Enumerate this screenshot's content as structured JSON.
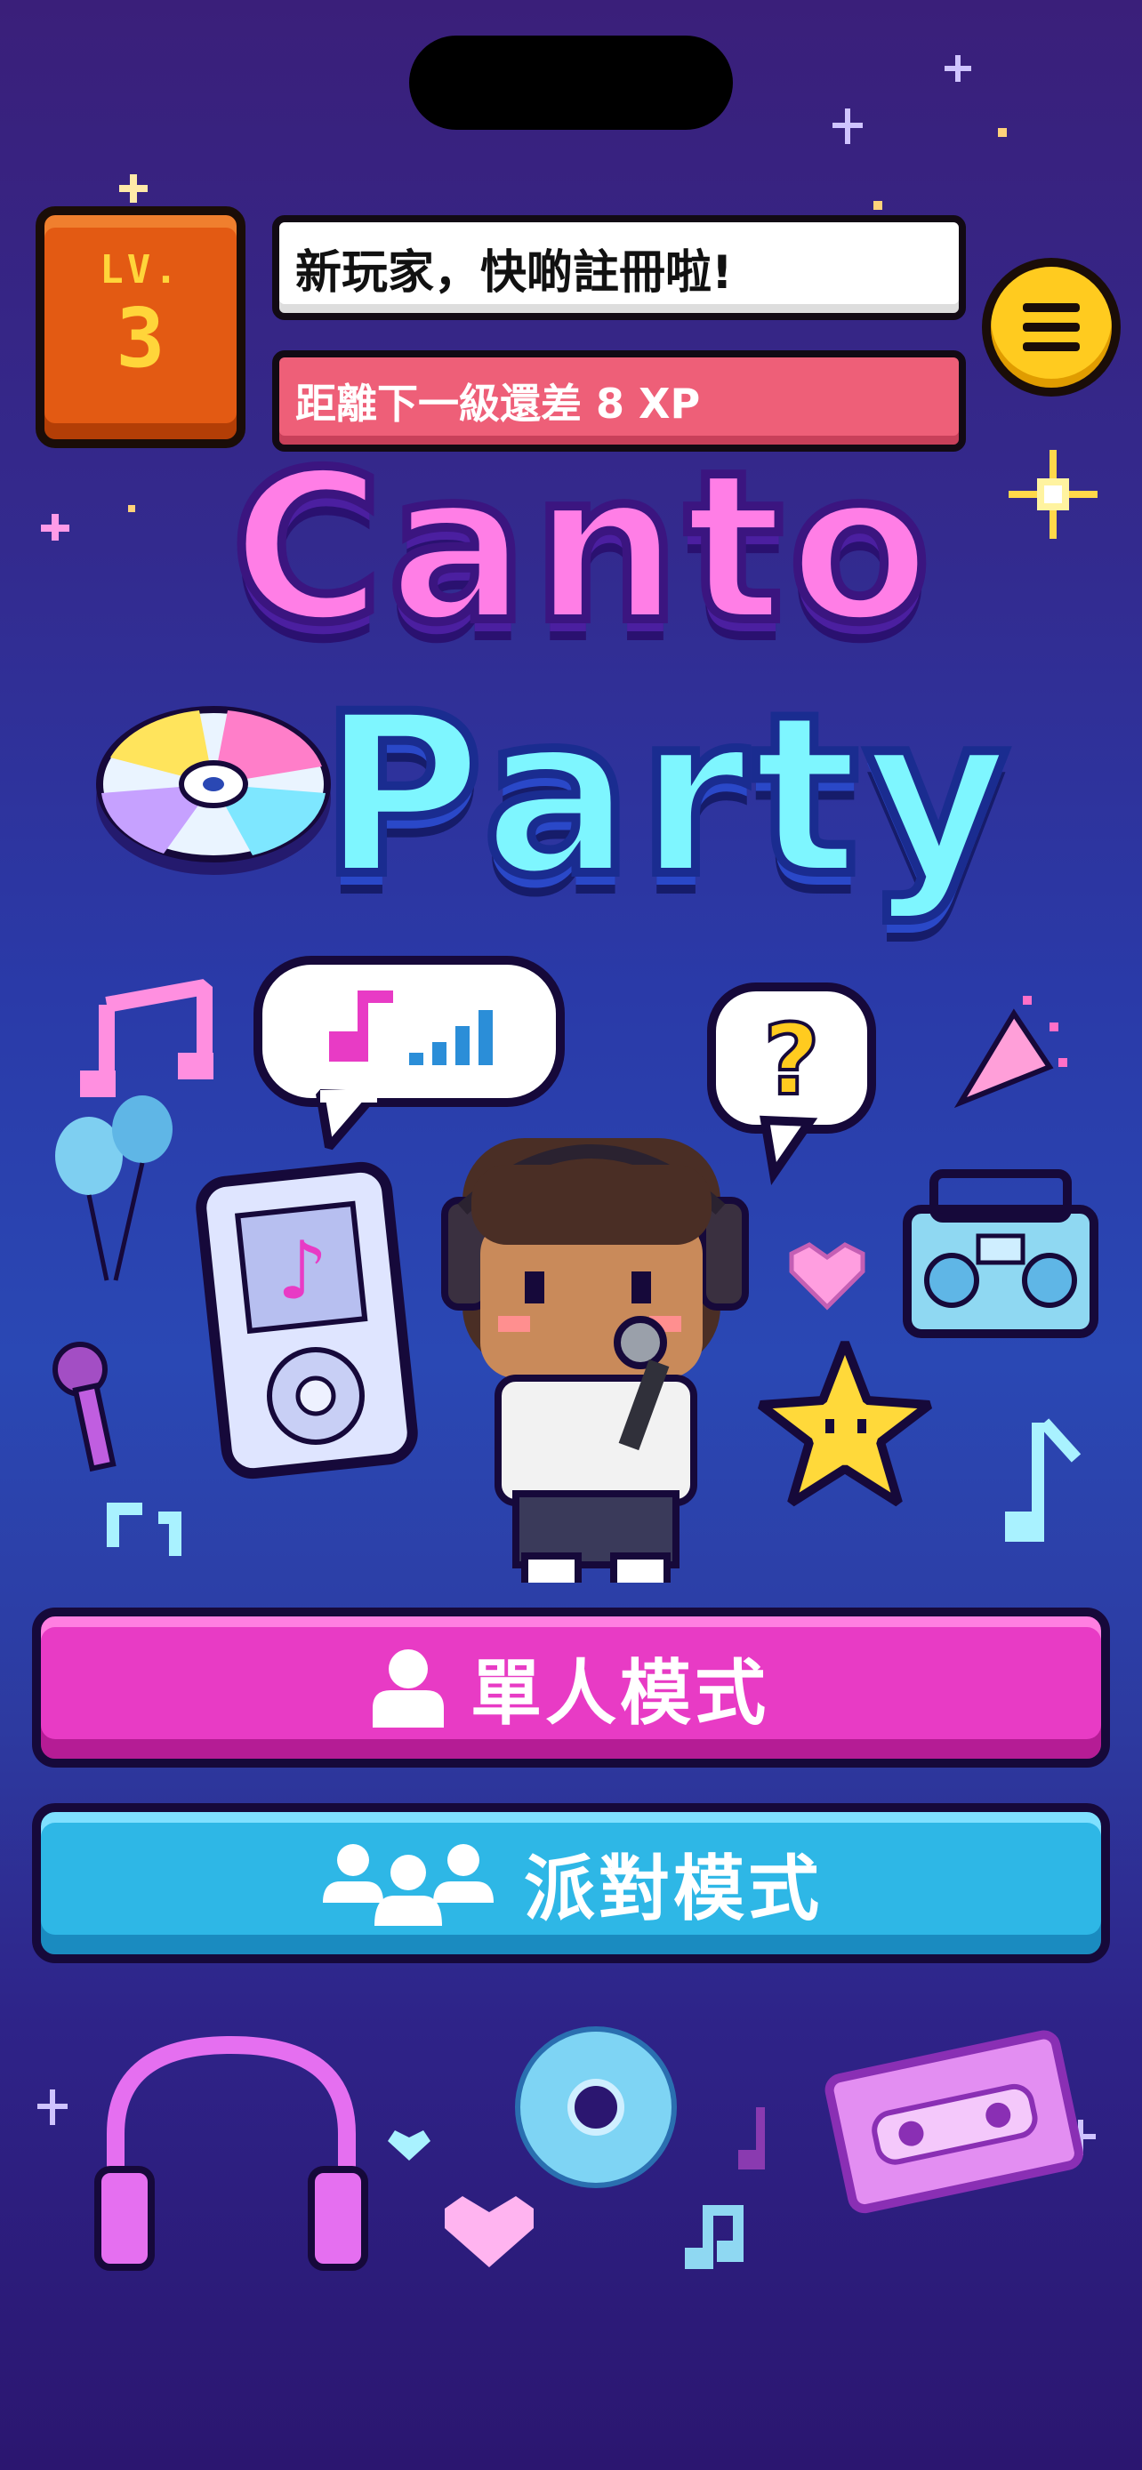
{
  "app": {
    "name": "Canto Party"
  },
  "header": {
    "level_label": "LV.",
    "level_value": "3",
    "register_prompt": "新玩家，快啲註冊啦!",
    "xp_message": "距離下一級還差 8 XP"
  },
  "title": {
    "line1": "Canto",
    "line2": "Party"
  },
  "buttons": {
    "solo_label": "單人模式",
    "party_label": "派對模式"
  },
  "colors": {
    "level_badge": "#e35a13",
    "menu_button": "#ffcb1f",
    "solo_button": "#e83bc5",
    "party_button": "#2eb7e6",
    "xp_banner": "#ee5f78"
  },
  "icons": [
    "menu-icon",
    "user-icon",
    "group-icon",
    "cd-icon",
    "music-note-icon",
    "headphones-icon",
    "cassette-icon",
    "boombox-icon",
    "star-icon",
    "heart-icon",
    "microphone-icon",
    "balloon-icon",
    "party-popper-icon",
    "mp3-player-icon",
    "question-bubble-icon"
  ]
}
